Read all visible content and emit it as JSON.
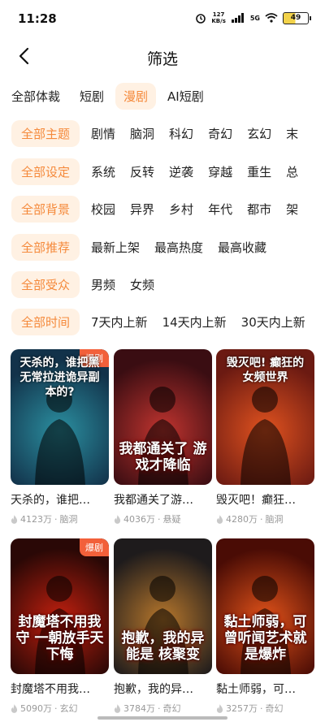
{
  "status": {
    "time": "11:28",
    "net_speed_value": "127",
    "net_speed_unit": "KB/s",
    "network": "5G",
    "battery": "49"
  },
  "header": {
    "title": "筛选"
  },
  "tabs": [
    {
      "label": "全部体裁",
      "active": false
    },
    {
      "label": "短剧",
      "active": false
    },
    {
      "label": "漫剧",
      "active": true
    },
    {
      "label": "AI短剧",
      "active": false
    }
  ],
  "filters": [
    {
      "chip": "全部主题",
      "options": [
        "剧情",
        "脑洞",
        "科幻",
        "奇幻",
        "玄幻",
        "末"
      ]
    },
    {
      "chip": "全部设定",
      "options": [
        "系统",
        "反转",
        "逆袭",
        "穿越",
        "重生",
        "总"
      ]
    },
    {
      "chip": "全部背景",
      "options": [
        "校园",
        "异界",
        "乡村",
        "年代",
        "都市",
        "架"
      ]
    },
    {
      "chip": "全部推荐",
      "options": [
        "最新上架",
        "最高热度",
        "最高收藏"
      ]
    },
    {
      "chip": "全部受众",
      "options": [
        "男频",
        "女频"
      ]
    },
    {
      "chip": "全部时间",
      "options": [
        "7天内上新",
        "14天内上新",
        "30天内上新"
      ]
    }
  ],
  "cards": [
    {
      "name": "天杀的，谁把…",
      "heat": "4123万",
      "tag": "脑洞",
      "badge": "爆剧",
      "cover_text": "天杀的，谁把黑无常拉进诡异副本的?",
      "cover_pos": "top",
      "bg": "#12324a",
      "bg2": "#2b8fa0"
    },
    {
      "name": "我都通关了游…",
      "heat": "4036万",
      "tag": "悬疑",
      "badge": "",
      "cover_text": "我都通关了 游戏才降临",
      "cover_pos": "bottom",
      "bg": "#3a0d12",
      "bg2": "#c0342f"
    },
    {
      "name": "毁灭吧！癫狂…",
      "heat": "4280万",
      "tag": "脑洞",
      "badge": "",
      "cover_text": "毁灭吧! 癫狂的女频世界",
      "cover_pos": "top",
      "bg": "#6b1a12",
      "bg2": "#e0521f"
    },
    {
      "name": "封魔塔不用我…",
      "heat": "5090万",
      "tag": "玄幻",
      "badge": "爆剧",
      "cover_text": "封魔塔不用我守 一朝放手天下悔",
      "cover_pos": "bottom",
      "bg": "#2a0806",
      "bg2": "#c2200f"
    },
    {
      "name": "抱歉，我的异…",
      "heat": "3784万",
      "tag": "奇幻",
      "badge": "",
      "cover_text": "抱歉，我的异能是 核聚变",
      "cover_pos": "bottom",
      "bg": "#1e1b1c",
      "bg2": "#b7772c"
    },
    {
      "name": "黏土师弱，可…",
      "heat": "3257万",
      "tag": "奇幻",
      "badge": "",
      "cover_text": "黏土师弱，可曾听闻艺术就是爆炸",
      "cover_pos": "bottom",
      "bg": "#4a0c05",
      "bg2": "#e2531a"
    }
  ]
}
